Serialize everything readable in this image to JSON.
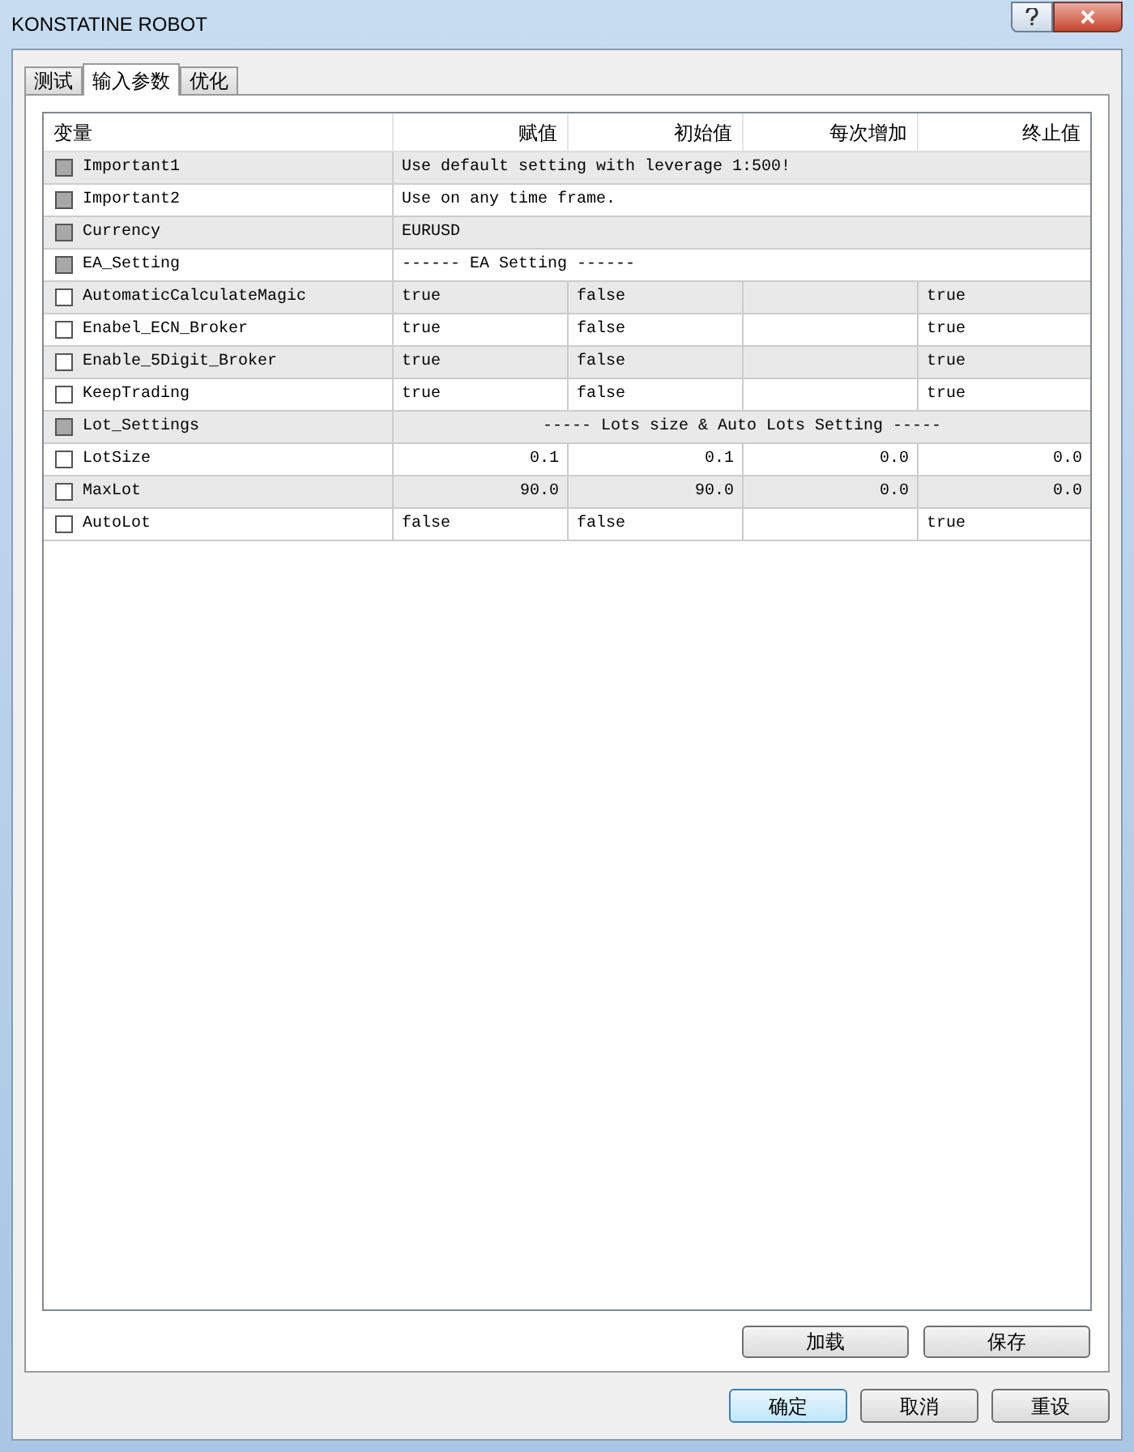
{
  "window": {
    "title": "KONSTATINE ROBOT"
  },
  "tabs": [
    {
      "label": "测试",
      "selected": false
    },
    {
      "label": "输入参数",
      "selected": true
    },
    {
      "label": "优化",
      "selected": false
    }
  ],
  "table": {
    "columns": [
      "变量",
      "赋值",
      "初始值",
      "每次增加",
      "终止值"
    ],
    "rows": [
      {
        "kind": "text",
        "name": "Important1",
        "checked": false,
        "disabled": true,
        "value": "Use default setting with leverage 1:500!"
      },
      {
        "kind": "text",
        "name": "Important2",
        "checked": false,
        "disabled": true,
        "value": "Use on any time frame."
      },
      {
        "kind": "text",
        "name": "Currency",
        "checked": false,
        "disabled": true,
        "value": "EURUSD"
      },
      {
        "kind": "text",
        "name": "EA_Setting",
        "checked": false,
        "disabled": true,
        "value": "------ EA Setting ------"
      },
      {
        "kind": "bool",
        "name": "AutomaticCalculateMagic",
        "checked": false,
        "disabled": false,
        "value": "true",
        "start": "false",
        "stop": "true"
      },
      {
        "kind": "bool",
        "name": "Enabel_ECN_Broker",
        "checked": false,
        "disabled": false,
        "value": "true",
        "start": "false",
        "stop": "true"
      },
      {
        "kind": "bool",
        "name": "Enable_5Digit_Broker",
        "checked": false,
        "disabled": false,
        "value": "true",
        "start": "false",
        "stop": "true"
      },
      {
        "kind": "bool",
        "name": "KeepTrading",
        "checked": false,
        "disabled": false,
        "value": "true",
        "start": "false",
        "stop": "true"
      },
      {
        "kind": "heading",
        "name": "Lot_Settings",
        "checked": false,
        "disabled": true,
        "value": "----- Lots size & Auto Lots Setting -----"
      },
      {
        "kind": "number",
        "name": "LotSize",
        "checked": false,
        "disabled": false,
        "value": "0.1",
        "start": "0.1",
        "step": "0.0",
        "stop": "0.0"
      },
      {
        "kind": "number",
        "name": "MaxLot",
        "checked": false,
        "disabled": false,
        "value": "90.0",
        "start": "90.0",
        "step": "0.0",
        "stop": "0.0"
      },
      {
        "kind": "bool",
        "name": "AutoLot",
        "checked": false,
        "disabled": false,
        "value": "false",
        "start": "false",
        "stop": "true"
      }
    ]
  },
  "panel_buttons": [
    "加载",
    "保存"
  ],
  "dialog_buttons": [
    {
      "label": "确定",
      "selected": true
    },
    {
      "label": "取消",
      "selected": false
    },
    {
      "label": "重设",
      "selected": false
    }
  ]
}
